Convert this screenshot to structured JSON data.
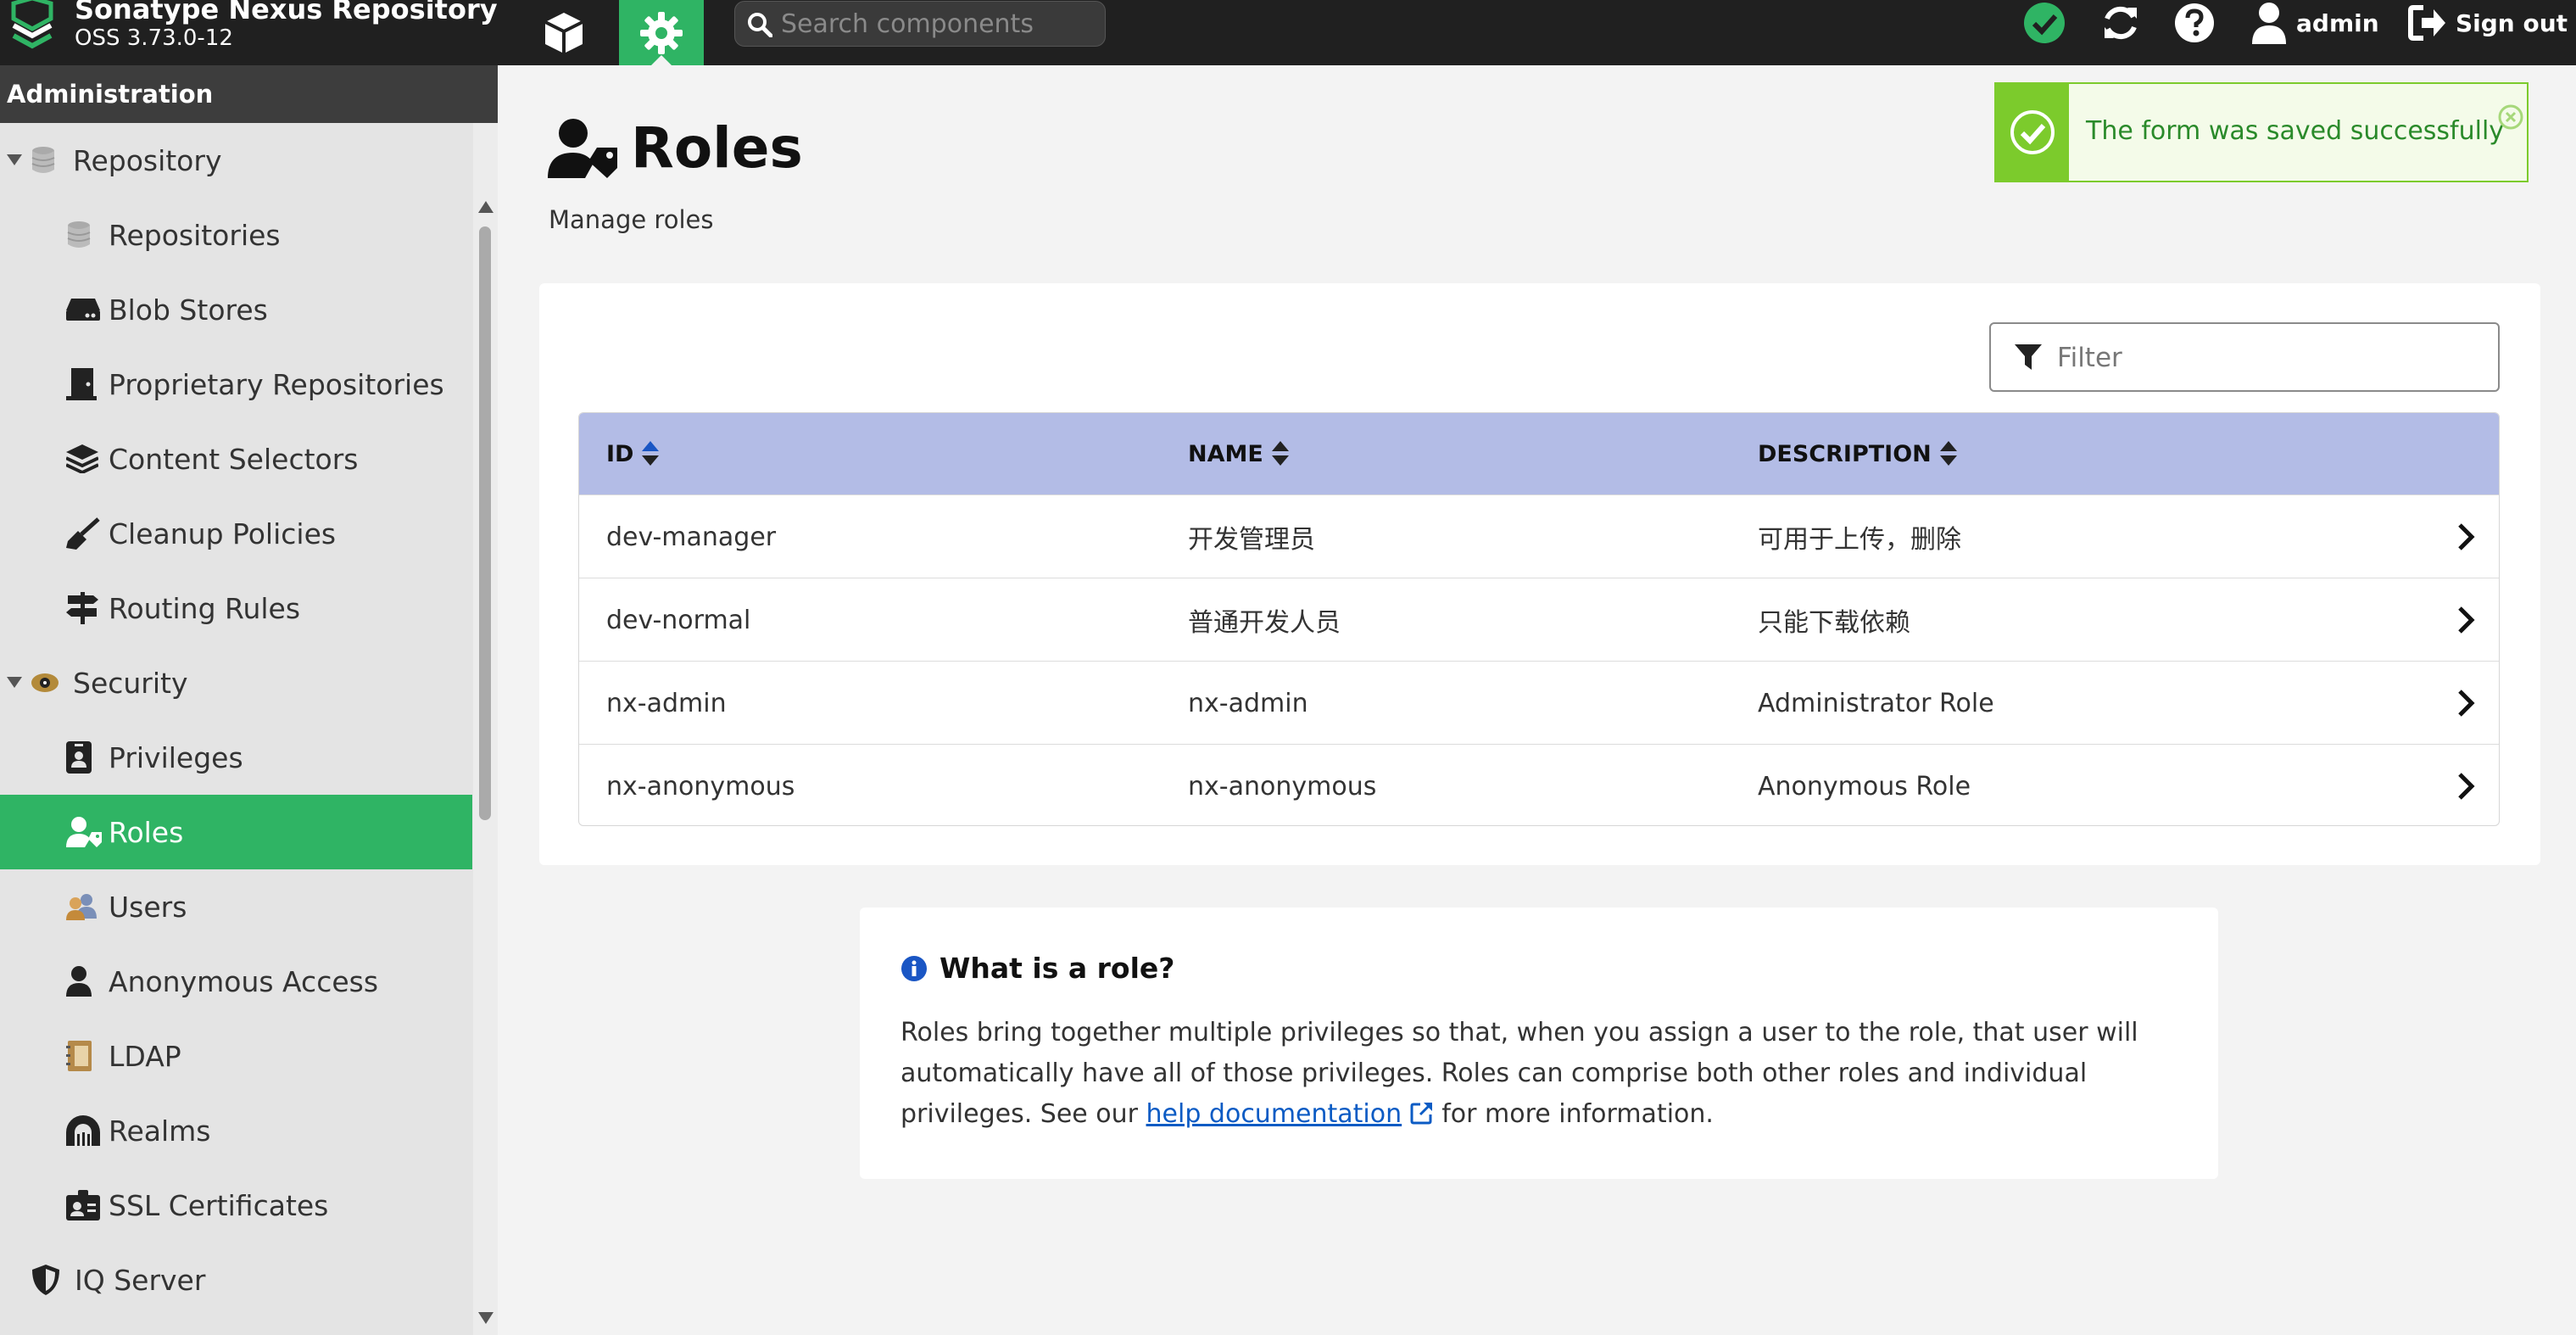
{
  "header": {
    "brand_name": "Sonatype Nexus Repository",
    "version": "OSS 3.73.0-12",
    "search_placeholder": "Search components",
    "user": "admin",
    "signout": "Sign out"
  },
  "sidebar": {
    "title": "Administration",
    "items": [
      {
        "label": "Repository",
        "icon": "database-icon"
      },
      {
        "label": "Repositories",
        "icon": "database-icon"
      },
      {
        "label": "Blob Stores",
        "icon": "hard-drive-icon"
      },
      {
        "label": "Proprietary Repositories",
        "icon": "door-icon"
      },
      {
        "label": "Content Selectors",
        "icon": "layers-icon"
      },
      {
        "label": "Cleanup Policies",
        "icon": "broom-icon"
      },
      {
        "label": "Routing Rules",
        "icon": "signpost-icon"
      },
      {
        "label": "Security",
        "icon": "eye-badge-icon"
      },
      {
        "label": "Privileges",
        "icon": "id-badge-icon"
      },
      {
        "label": "Roles",
        "icon": "user-tag-icon"
      },
      {
        "label": "Users",
        "icon": "users-icon"
      },
      {
        "label": "Anonymous Access",
        "icon": "user-icon"
      },
      {
        "label": "LDAP",
        "icon": "address-book-icon"
      },
      {
        "label": "Realms",
        "icon": "dungeon-icon"
      },
      {
        "label": "SSL Certificates",
        "icon": "certificate-icon"
      },
      {
        "label": "IQ Server",
        "icon": "shield-icon"
      }
    ]
  },
  "page": {
    "title": "Roles",
    "subtitle": "Manage roles"
  },
  "toast": {
    "message": "The form was saved successfully"
  },
  "filter": {
    "placeholder": "Filter"
  },
  "table": {
    "columns": [
      "ID",
      "NAME",
      "DESCRIPTION"
    ],
    "rows": [
      {
        "id": "dev-manager",
        "name": "开发管理员",
        "description": "可用于上传，删除"
      },
      {
        "id": "dev-normal",
        "name": "普通开发人员",
        "description": "只能下载依赖"
      },
      {
        "id": "nx-admin",
        "name": "nx-admin",
        "description": "Administrator Role"
      },
      {
        "id": "nx-anonymous",
        "name": "nx-anonymous",
        "description": "Anonymous Role"
      }
    ]
  },
  "info": {
    "title": "What is a role?",
    "body_before": "Roles bring together multiple privileges so that, when you assign a user to the role, that user will automatically have all of those privileges. Roles can comprise both other roles and individual privileges. See our ",
    "link_text": "help documentation",
    "body_after": " for more information."
  },
  "colors": {
    "accent": "#2fb464",
    "header_bg": "#202020",
    "table_header": "#b3bce6",
    "toast": "#7ccb2c",
    "link": "#0b5bc4"
  }
}
